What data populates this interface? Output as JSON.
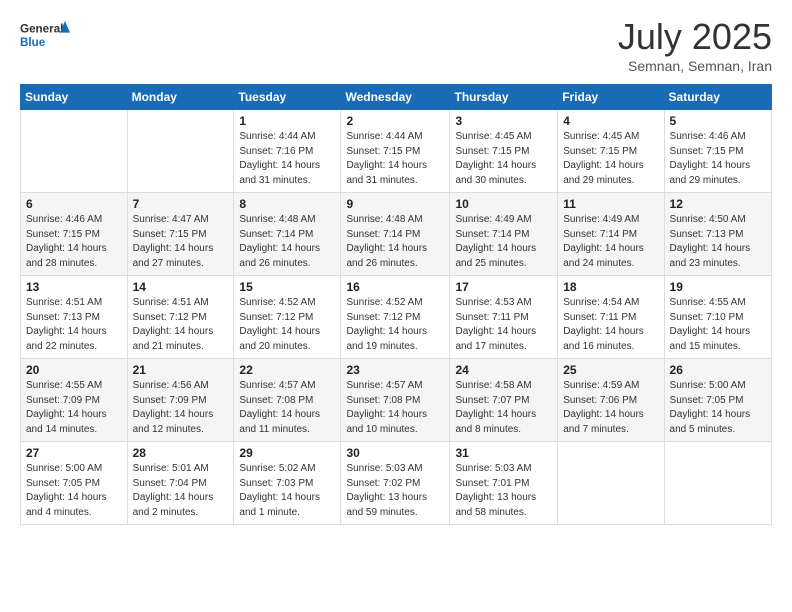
{
  "header": {
    "logo_general": "General",
    "logo_blue": "Blue",
    "month": "July 2025",
    "location": "Semnan, Semnan, Iran"
  },
  "days_of_week": [
    "Sunday",
    "Monday",
    "Tuesday",
    "Wednesday",
    "Thursday",
    "Friday",
    "Saturday"
  ],
  "weeks": [
    [
      {
        "day": "",
        "info": ""
      },
      {
        "day": "",
        "info": ""
      },
      {
        "day": "1",
        "info": "Sunrise: 4:44 AM\nSunset: 7:16 PM\nDaylight: 14 hours and 31 minutes."
      },
      {
        "day": "2",
        "info": "Sunrise: 4:44 AM\nSunset: 7:15 PM\nDaylight: 14 hours and 31 minutes."
      },
      {
        "day": "3",
        "info": "Sunrise: 4:45 AM\nSunset: 7:15 PM\nDaylight: 14 hours and 30 minutes."
      },
      {
        "day": "4",
        "info": "Sunrise: 4:45 AM\nSunset: 7:15 PM\nDaylight: 14 hours and 29 minutes."
      },
      {
        "day": "5",
        "info": "Sunrise: 4:46 AM\nSunset: 7:15 PM\nDaylight: 14 hours and 29 minutes."
      }
    ],
    [
      {
        "day": "6",
        "info": "Sunrise: 4:46 AM\nSunset: 7:15 PM\nDaylight: 14 hours and 28 minutes."
      },
      {
        "day": "7",
        "info": "Sunrise: 4:47 AM\nSunset: 7:15 PM\nDaylight: 14 hours and 27 minutes."
      },
      {
        "day": "8",
        "info": "Sunrise: 4:48 AM\nSunset: 7:14 PM\nDaylight: 14 hours and 26 minutes."
      },
      {
        "day": "9",
        "info": "Sunrise: 4:48 AM\nSunset: 7:14 PM\nDaylight: 14 hours and 26 minutes."
      },
      {
        "day": "10",
        "info": "Sunrise: 4:49 AM\nSunset: 7:14 PM\nDaylight: 14 hours and 25 minutes."
      },
      {
        "day": "11",
        "info": "Sunrise: 4:49 AM\nSunset: 7:14 PM\nDaylight: 14 hours and 24 minutes."
      },
      {
        "day": "12",
        "info": "Sunrise: 4:50 AM\nSunset: 7:13 PM\nDaylight: 14 hours and 23 minutes."
      }
    ],
    [
      {
        "day": "13",
        "info": "Sunrise: 4:51 AM\nSunset: 7:13 PM\nDaylight: 14 hours and 22 minutes."
      },
      {
        "day": "14",
        "info": "Sunrise: 4:51 AM\nSunset: 7:12 PM\nDaylight: 14 hours and 21 minutes."
      },
      {
        "day": "15",
        "info": "Sunrise: 4:52 AM\nSunset: 7:12 PM\nDaylight: 14 hours and 20 minutes."
      },
      {
        "day": "16",
        "info": "Sunrise: 4:52 AM\nSunset: 7:12 PM\nDaylight: 14 hours and 19 minutes."
      },
      {
        "day": "17",
        "info": "Sunrise: 4:53 AM\nSunset: 7:11 PM\nDaylight: 14 hours and 17 minutes."
      },
      {
        "day": "18",
        "info": "Sunrise: 4:54 AM\nSunset: 7:11 PM\nDaylight: 14 hours and 16 minutes."
      },
      {
        "day": "19",
        "info": "Sunrise: 4:55 AM\nSunset: 7:10 PM\nDaylight: 14 hours and 15 minutes."
      }
    ],
    [
      {
        "day": "20",
        "info": "Sunrise: 4:55 AM\nSunset: 7:09 PM\nDaylight: 14 hours and 14 minutes."
      },
      {
        "day": "21",
        "info": "Sunrise: 4:56 AM\nSunset: 7:09 PM\nDaylight: 14 hours and 12 minutes."
      },
      {
        "day": "22",
        "info": "Sunrise: 4:57 AM\nSunset: 7:08 PM\nDaylight: 14 hours and 11 minutes."
      },
      {
        "day": "23",
        "info": "Sunrise: 4:57 AM\nSunset: 7:08 PM\nDaylight: 14 hours and 10 minutes."
      },
      {
        "day": "24",
        "info": "Sunrise: 4:58 AM\nSunset: 7:07 PM\nDaylight: 14 hours and 8 minutes."
      },
      {
        "day": "25",
        "info": "Sunrise: 4:59 AM\nSunset: 7:06 PM\nDaylight: 14 hours and 7 minutes."
      },
      {
        "day": "26",
        "info": "Sunrise: 5:00 AM\nSunset: 7:05 PM\nDaylight: 14 hours and 5 minutes."
      }
    ],
    [
      {
        "day": "27",
        "info": "Sunrise: 5:00 AM\nSunset: 7:05 PM\nDaylight: 14 hours and 4 minutes."
      },
      {
        "day": "28",
        "info": "Sunrise: 5:01 AM\nSunset: 7:04 PM\nDaylight: 14 hours and 2 minutes."
      },
      {
        "day": "29",
        "info": "Sunrise: 5:02 AM\nSunset: 7:03 PM\nDaylight: 14 hours and 1 minute."
      },
      {
        "day": "30",
        "info": "Sunrise: 5:03 AM\nSunset: 7:02 PM\nDaylight: 13 hours and 59 minutes."
      },
      {
        "day": "31",
        "info": "Sunrise: 5:03 AM\nSunset: 7:01 PM\nDaylight: 13 hours and 58 minutes."
      },
      {
        "day": "",
        "info": ""
      },
      {
        "day": "",
        "info": ""
      }
    ]
  ]
}
